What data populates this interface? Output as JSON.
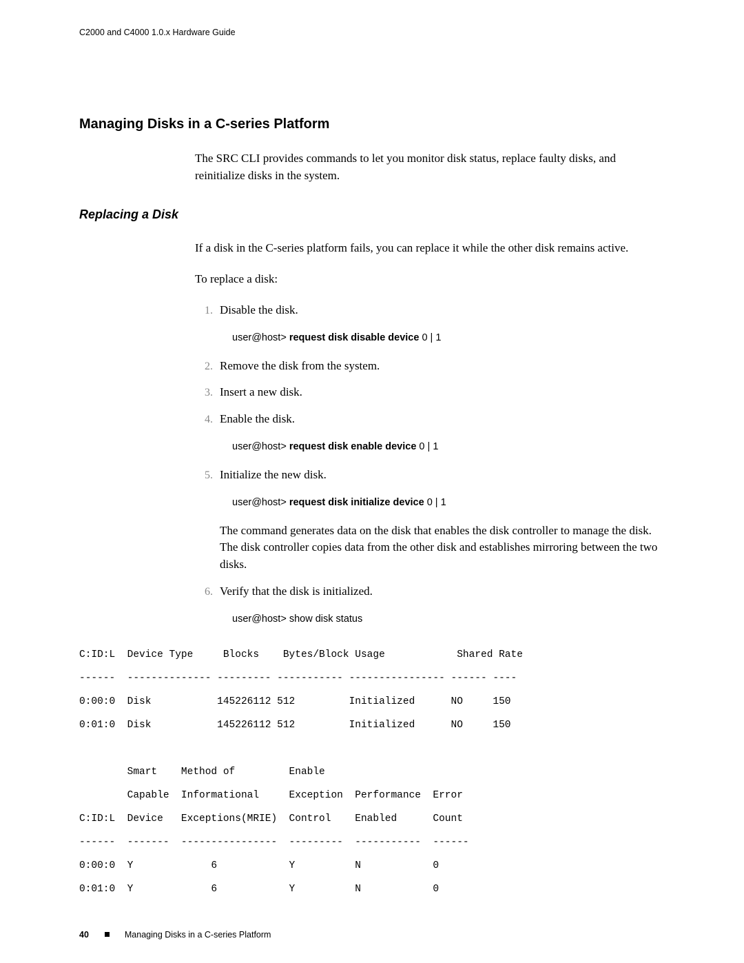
{
  "running_head": "C2000 and C4000 1.0.x Hardware Guide",
  "section_h1": "Managing Disks in a C-series Platform",
  "intro": "The SRC CLI provides commands to let you monitor disk status, replace faulty disks, and reinitialize disks in the system.",
  "subsection_h2": "Replacing a Disk",
  "sub_para1": "If a disk in the C-series platform fails, you can replace it while the other disk remains active.",
  "sub_para2": "To replace a disk:",
  "steps": {
    "s1": {
      "text": "Disable the disk.",
      "cmd_prefix": "user@host> ",
      "cmd_bold": "request disk disable device",
      "cmd_suffix": " 0 | 1"
    },
    "s2": {
      "text": "Remove the disk from the system."
    },
    "s3": {
      "text": "Insert a new disk."
    },
    "s4": {
      "text": "Enable the disk.",
      "cmd_prefix": "user@host> ",
      "cmd_bold": "request disk enable device",
      "cmd_suffix": " 0 | 1"
    },
    "s5": {
      "text": "Initialize the new disk.",
      "cmd_prefix": "user@host> ",
      "cmd_bold": "request disk initialize device",
      "cmd_suffix": " 0 | 1",
      "note": "The command generates data on the disk that enables the disk controller to manage the disk. The disk controller copies data from the other disk and establishes mirroring between the two disks."
    },
    "s6": {
      "text": "Verify that the disk is initialized.",
      "cmd_prefix": "user@host> ",
      "cmd_plain": "show disk status"
    }
  },
  "terminal": "C:ID:L  Device Type     Blocks    Bytes/Block Usage            Shared Rate\n------  -------------- --------- ----------- ---------------- ------ ----\n0:00:0  Disk           145226112 512         Initialized      NO     150\n0:01:0  Disk           145226112 512         Initialized      NO     150\n\n        Smart    Method of         Enable\n        Capable  Informational     Exception  Performance  Error\nC:ID:L  Device   Exceptions(MRIE)  Control    Enabled      Count\n------  -------  ----------------  ---------  -----------  ------\n0:00:0  Y             6            Y          N            0\n0:01:0  Y             6            Y          N            0",
  "footer": {
    "page_number": "40",
    "title": "Managing Disks in a C-series Platform"
  }
}
